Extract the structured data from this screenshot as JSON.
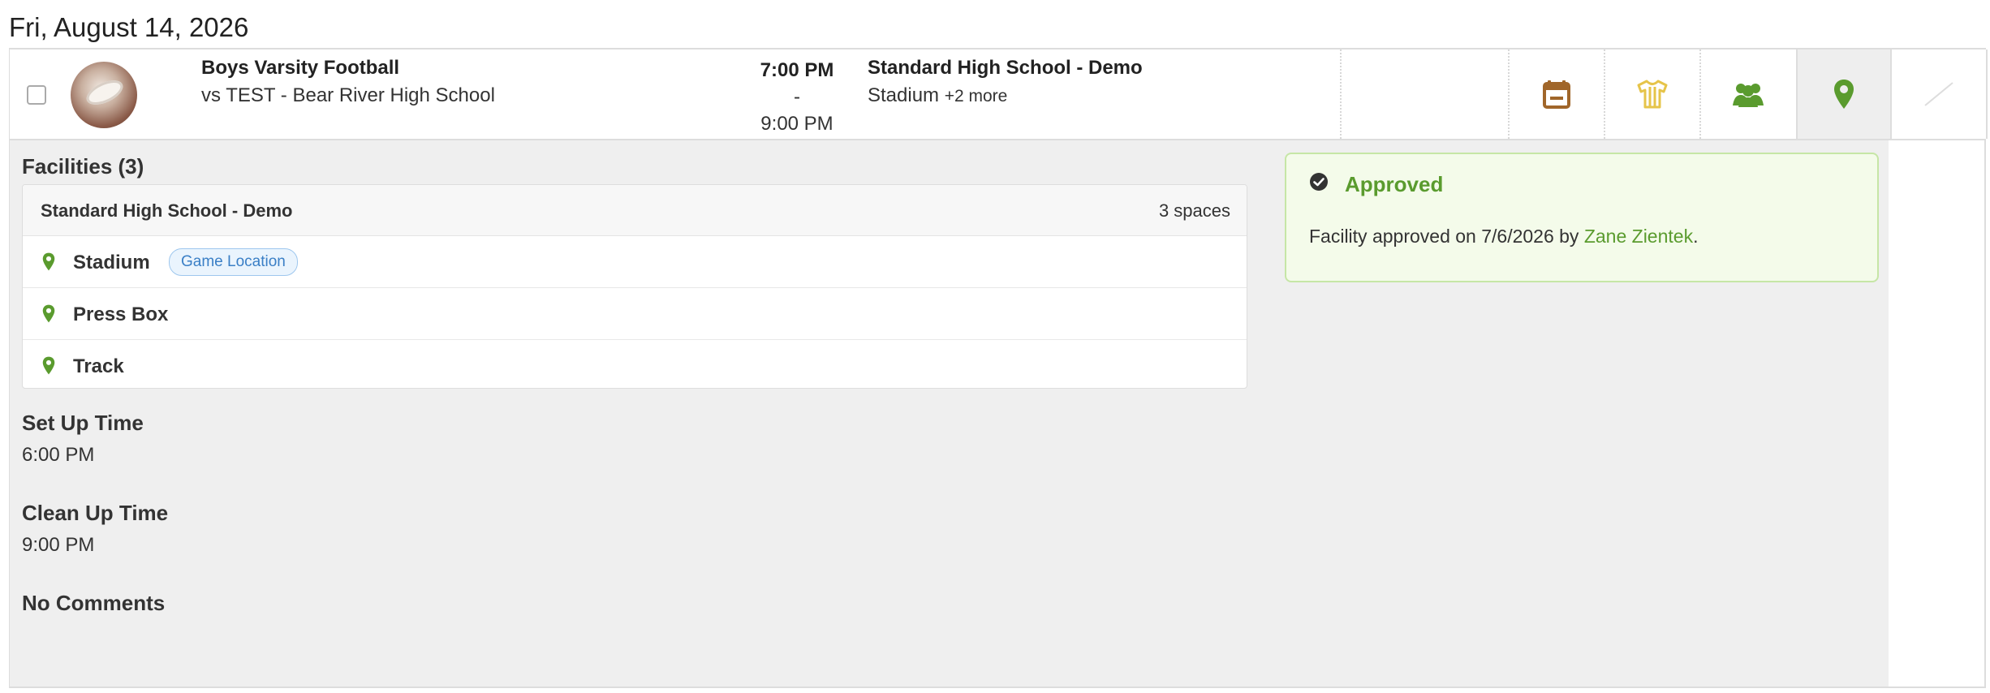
{
  "date_header": "Fri, August 14, 2026",
  "event": {
    "title": "Boys Varsity Football",
    "opponent": "vs TEST - Bear River High School",
    "time_start": "7:00 PM",
    "time_sep": "-",
    "time_end": "9:00 PM",
    "location_title": "Standard High School - Demo",
    "location_primary": "Stadium",
    "location_more": "+2 more"
  },
  "row_icons": [
    "calendar-icon",
    "jersey-icon",
    "team-icon",
    "map-pin-icon",
    "slash-icon"
  ],
  "colors": {
    "calendar": "#a0662a",
    "jersey": "#e6c44a",
    "team": "#5a9b2e",
    "pin": "#5a9b2e",
    "approved": "#5a9b2e",
    "tag_text": "#3a7fc6"
  },
  "details": {
    "facilities_heading": "Facilities (3)",
    "school": "Standard High School - Demo",
    "spaces": "3 spaces",
    "facilities": [
      {
        "name": "Stadium",
        "tag": "Game Location"
      },
      {
        "name": "Press Box"
      },
      {
        "name": "Track"
      }
    ],
    "setup_label": "Set Up Time",
    "setup_value": "6:00 PM",
    "cleanup_label": "Clean Up Time",
    "cleanup_value": "9:00 PM",
    "comments_label": "No Comments"
  },
  "approval": {
    "status": "Approved",
    "message_prefix": "Facility approved on 7/6/2026 by ",
    "approver": "Zane Zientek",
    "message_suffix": "."
  }
}
